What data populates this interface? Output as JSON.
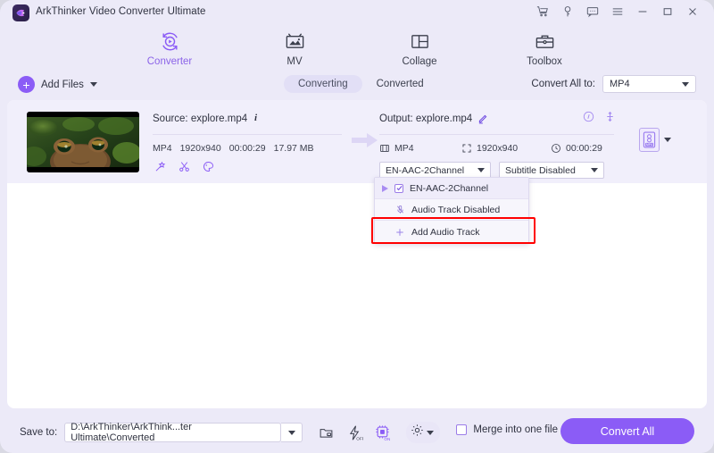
{
  "window": {
    "title": "ArkThinker Video Converter Ultimate",
    "controls": [
      {
        "name": "cart-icon",
        "label": "Cart"
      },
      {
        "name": "key-icon",
        "label": "Register"
      },
      {
        "name": "feedback-icon",
        "label": "Feedback"
      },
      {
        "name": "menu-icon",
        "label": "Menu"
      },
      {
        "name": "minimize-icon",
        "label": "Minimize"
      },
      {
        "name": "maximize-icon",
        "label": "Maximize"
      },
      {
        "name": "close-icon",
        "label": "Close"
      }
    ]
  },
  "nav": {
    "tabs": [
      {
        "label": "Converter",
        "icon": "converter-icon",
        "active": true
      },
      {
        "label": "MV",
        "icon": "mv-icon",
        "active": false
      },
      {
        "label": "Collage",
        "icon": "collage-icon",
        "active": false
      },
      {
        "label": "Toolbox",
        "icon": "toolbox-icon",
        "active": false
      }
    ]
  },
  "actionbar": {
    "add_files_label": "Add Files",
    "segments": [
      {
        "label": "Converting",
        "active": true
      },
      {
        "label": "Converted",
        "active": false
      }
    ],
    "convert_all_to_label": "Convert All to:",
    "convert_all_to_value": "MP4"
  },
  "file": {
    "source": {
      "label": "Source: explore.mp4",
      "format": "MP4",
      "resolution": "1920x940",
      "duration": "00:00:29",
      "size": "17.97 MB",
      "tools": [
        {
          "name": "magic-wand-icon",
          "label": "Enhance"
        },
        {
          "name": "scissors-icon",
          "label": "Trim"
        },
        {
          "name": "palette-icon",
          "label": "Edit"
        }
      ]
    },
    "output": {
      "label": "Output: explore.mp4",
      "format": "MP4",
      "resolution": "1920x940",
      "duration": "00:00:29",
      "audio_track": "EN-AAC-2Channel",
      "subtitle": "Subtitle Disabled",
      "format_badge": "MP4"
    }
  },
  "dropdown": {
    "items": [
      {
        "label": "EN-AAC-2Channel",
        "icon": "checkbox-checked-icon",
        "selected": true
      },
      {
        "label": "Audio Track Disabled",
        "icon": "microphone-off-icon",
        "selected": false
      },
      {
        "label": "Add Audio Track",
        "icon": "plus-icon",
        "selected": false,
        "highlighted": true
      }
    ],
    "highlight_color": "#ff0000"
  },
  "bottom": {
    "save_to_label": "Save to:",
    "save_to_path": "D:\\ArkThinker\\ArkThink...ter Ultimate\\Converted",
    "icons": [
      {
        "name": "open-folder-icon",
        "label": "Open folder"
      },
      {
        "name": "fast-conversion-off-icon",
        "label": "OFF"
      },
      {
        "name": "gpu-acceleration-on-icon",
        "label": "ON"
      },
      {
        "name": "gear-icon",
        "label": "Preferences"
      }
    ],
    "merge_label": "Merge into one file",
    "merge_checked": false,
    "convert_all_label": "Convert All"
  },
  "colors": {
    "accent": "#8b5cf6",
    "panel_bg": "#ffffff",
    "app_bg": "#eceaf8",
    "card_bg": "#f1effb",
    "highlight": "#ff0000"
  }
}
